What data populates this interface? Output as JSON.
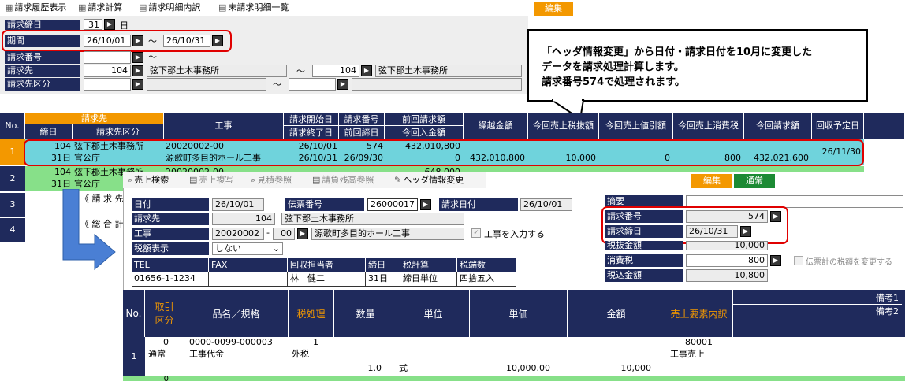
{
  "top_toolbar": [
    "請求履歴表示",
    "請求計算",
    "請求明細内訳",
    "未請求明細一覧"
  ],
  "top_edit_btn": "編集",
  "filter": {
    "row0_label": "請求締日",
    "row0_value": "31",
    "row0_unit": "日",
    "period_label": "期間",
    "period_from": "26/10/01",
    "period_to": "26/10/31",
    "tilde": "～",
    "bill_no_label": "請求番号",
    "billto_label": "請求先",
    "billto_from_code": "104",
    "billto_from_name": "弦下郡土木事務所",
    "billto_to_code": "104",
    "billto_to_name": "弦下郡土木事務所",
    "billto_cat_label": "請求先区分"
  },
  "callout": {
    "line1": "「ヘッダ情報変更」から日付・請求日付を10月に変更した",
    "line2": "データを請求処理計算します。",
    "line3": "請求番号574で処理されます。"
  },
  "grid": {
    "h_no": "No.",
    "h_billto": "請求先",
    "h_close": "締日",
    "h_cat": "請求先区分",
    "h_work": "工事",
    "h_start": "請求開始日",
    "h_end": "請求終了日",
    "h_billno": "請求番号",
    "h_prevdate": "前回締日",
    "h_prevamt": "前回請求額",
    "h_recv": "今回入金額",
    "h_carry": "繰越金額",
    "h_sales": "今回売上税抜額",
    "h_disc": "今回売上値引額",
    "h_tax": "今回売上消費税",
    "h_total": "今回請求額",
    "h_due": "回収予定日",
    "rows": [
      {
        "no": "1",
        "code": "104",
        "name": "弦下郡土木事務所",
        "close": "31日",
        "cat": "官公庁",
        "work_code": "20020002-00",
        "work_name": "源歌町多目的ホール工事",
        "start": "26/10/01",
        "end": "26/10/31",
        "billno": "574",
        "prevdate": "26/09/30",
        "prevamt": "432,010,800",
        "recv": "0",
        "carry": "432,010,800",
        "sales": "10,000",
        "disc": "0",
        "tax": "800",
        "total": "432,021,600",
        "due": "26/11/30"
      },
      {
        "no": "2",
        "code": "104",
        "name": "弦下郡土木事務所",
        "close": "31日",
        "cat": "官公庁",
        "work_code": "20020002-00",
        "work_name": "",
        "start": "",
        "end": "",
        "billno": "",
        "prevdate": "",
        "prevamt": "648,000",
        "recv": ""
      },
      {
        "no": "3",
        "text": "《 請 求 先"
      },
      {
        "no": "4",
        "text": "《 総 合 計"
      }
    ]
  },
  "dialog": {
    "tabs": [
      "売上検索",
      "売上複写",
      "見積参照",
      "請負残高参照",
      "ヘッダ情報変更"
    ],
    "edit": "編集",
    "normal": "通常",
    "date_label": "日付",
    "date": "26/10/01",
    "slip_label": "伝票番号",
    "slip": "26000017",
    "bill_date_label": "請求日付",
    "bill_date": "26/10/01",
    "cust_label": "請求先",
    "cust_code": "104",
    "cust_name": "弦下郡土木事務所",
    "work_label": "工事",
    "work_code": "20020002",
    "work_sub": "00",
    "work_name": "源歌町多目的ホール工事",
    "work_check": "工事を入力する",
    "taxdisp_label": "税額表示",
    "taxdisp": "しない",
    "info_headers": [
      "TEL",
      "FAX",
      "回収担当者",
      "締日",
      "税計算",
      "税端数"
    ],
    "info_values": [
      "01656-1-1234",
      "",
      "林　健二",
      "31日",
      "締日単位",
      "四捨五入"
    ],
    "summary_label": "摘要",
    "billno_label": "請求番号",
    "billno": "574",
    "close_label": "請求締日",
    "close": "26/10/31",
    "excl_label": "税抜金額",
    "excl": "10,000",
    "tax_label": "消費税",
    "tax": "800",
    "tax_check": "伝票計の税額を変更する",
    "incl_label": "税込金額",
    "incl": "10,800"
  },
  "detail": {
    "h_no": "No.",
    "h_kind1": "取引",
    "h_kind2": "区分",
    "h_item": "品名／規格",
    "h_taxproc": "税処理",
    "h_qty": "数量",
    "h_unit": "単位",
    "h_price": "単価",
    "h_amount": "金額",
    "h_sales": "売上要素内訳",
    "h_note1": "備考1",
    "h_note2": "備考2",
    "row": {
      "no": "1",
      "kind_code": "0",
      "kind": "通常",
      "item_code": "0000-0099-000003",
      "item": "工事代金",
      "tax_code": "1",
      "tax": "外税",
      "qty": "1.0",
      "unit": "式",
      "price": "10,000.00",
      "amount": "10,000",
      "sales_code": "80001",
      "sales": "工事売上"
    },
    "next_kind": "0"
  }
}
